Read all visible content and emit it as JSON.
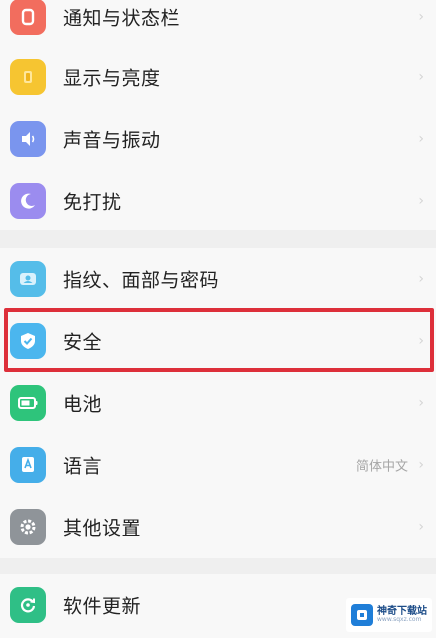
{
  "settings": {
    "group1": [
      {
        "key": "notifications",
        "label": "通知与状态栏",
        "icon": "notification-icon",
        "color": "#f26d5e"
      },
      {
        "key": "display",
        "label": "显示与亮度",
        "icon": "display-brightness-icon",
        "color": "#f6c531"
      },
      {
        "key": "sound",
        "label": "声音与振动",
        "icon": "speaker-icon",
        "color": "#7a95ee"
      },
      {
        "key": "dnd",
        "label": "免打扰",
        "icon": "moon-icon",
        "color": "#9b8cef"
      }
    ],
    "group2": [
      {
        "key": "fingerprint",
        "label": "指纹、面部与密码",
        "icon": "fingerprint-face-icon",
        "color": "#55bde9"
      },
      {
        "key": "security",
        "label": "安全",
        "icon": "shield-check-icon",
        "color": "#4bb6ee"
      },
      {
        "key": "battery",
        "label": "电池",
        "icon": "battery-icon",
        "color": "#2ec47b"
      },
      {
        "key": "language",
        "label": "语言",
        "value": "简体中文",
        "icon": "language-icon",
        "color": "#45aee9"
      },
      {
        "key": "other",
        "label": "其他设置",
        "icon": "gear-icon",
        "color": "#8f9499"
      }
    ],
    "group3": [
      {
        "key": "update",
        "label": "软件更新",
        "icon": "update-icon",
        "color": "#2fbf86"
      }
    ]
  },
  "highlight_color": "#dd2f3a",
  "watermark": {
    "text": "神奇下载站",
    "url": "www.sqxz.com"
  }
}
